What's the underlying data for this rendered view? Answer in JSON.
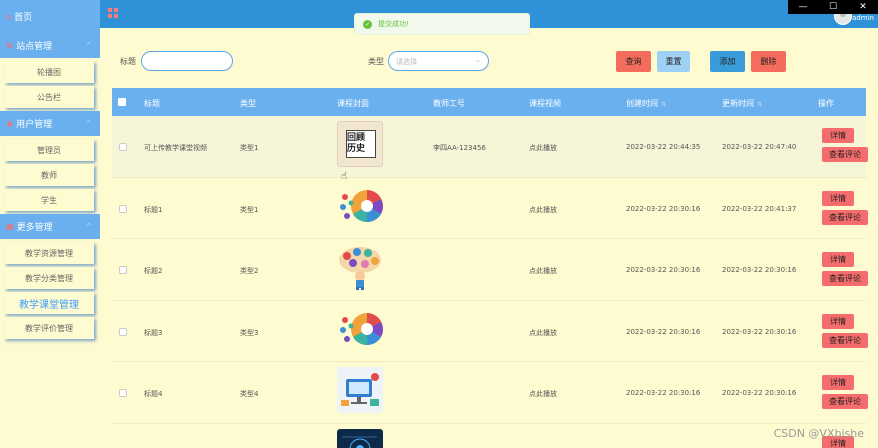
{
  "sidebar": {
    "home": "首页",
    "groups": [
      {
        "label": "站点管理",
        "items": [
          "轮播图",
          "公告栏"
        ]
      },
      {
        "label": "用户管理",
        "items": [
          "管理员",
          "教师",
          "学生"
        ]
      },
      {
        "label": "更多管理",
        "items": [
          "教学资源管理",
          "教学分类管理",
          "教学课堂管理",
          "教学评价管理"
        ]
      }
    ],
    "active_item": "教学课堂管理"
  },
  "header": {
    "title": "",
    "username": "admin"
  },
  "toast": {
    "message": "提交成功!"
  },
  "search": {
    "title_label": "标题",
    "type_label": "类型",
    "type_placeholder": "请选择",
    "query_button": "查询",
    "reset_button": "重置",
    "add_button": "添加",
    "delete_button": "删除"
  },
  "colors": {
    "query": "#f36c5e",
    "reset": "#9fd0f5",
    "add": "#3a9bd9",
    "delete": "#f36c5e"
  },
  "table": {
    "columns": [
      "标题",
      "类型",
      "课程封面",
      "教师工号",
      "课程视频",
      "创建时间",
      "更新时间",
      "操作"
    ],
    "rows": [
      {
        "title": "可上传教学课堂视频",
        "type": "类型1",
        "cover": "回顾 历史",
        "teacher": "李四AA-123456",
        "video": "点此播放",
        "created": "2022-03-22 20:44:35",
        "updated": "2022-03-22 20:47:40"
      },
      {
        "title": "标题1",
        "type": "类型1",
        "cover": "",
        "teacher": "",
        "video": "点此播放",
        "created": "2022-03-22 20:30:16",
        "updated": "2022-03-22 20:41:37"
      },
      {
        "title": "标题2",
        "type": "类型2",
        "cover": "",
        "teacher": "",
        "video": "点此播放",
        "created": "2022-03-22 20:30:16",
        "updated": "2022-03-22 20:30:16"
      },
      {
        "title": "标题3",
        "type": "类型3",
        "cover": "",
        "teacher": "",
        "video": "点此播放",
        "created": "2022-03-22 20:30:16",
        "updated": "2022-03-22 20:30:16"
      },
      {
        "title": "标题4",
        "type": "类型4",
        "cover": "",
        "teacher": "",
        "video": "点此播放",
        "created": "2022-03-22 20:30:16",
        "updated": "2022-03-22 20:30:16"
      }
    ],
    "detail_button": "详情",
    "comment_button": "查看评论"
  },
  "watermark": "CSDN @VXbishe"
}
